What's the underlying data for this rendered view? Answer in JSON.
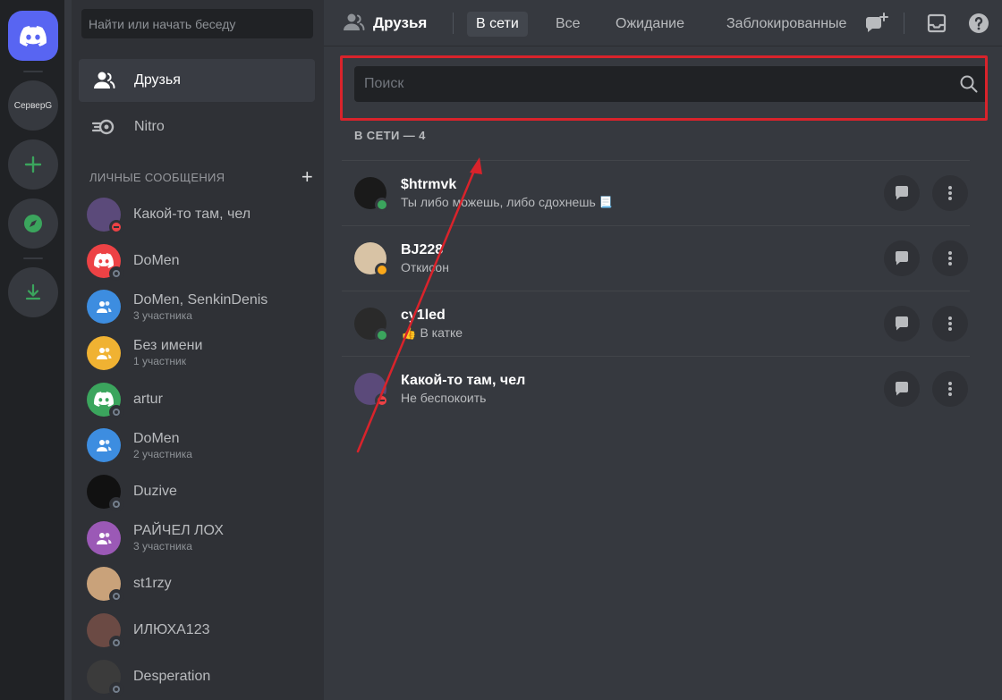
{
  "rail": {
    "server_label": "СерверG"
  },
  "sidebar": {
    "search_label": "Найти или начать беседу",
    "nav": [
      {
        "label": "Друзья"
      },
      {
        "label": "Nitro"
      }
    ],
    "dm_header": "ЛИЧНЫЕ СООБЩЕНИЯ",
    "dm_add": "+",
    "dms": [
      {
        "name": "Какой-то там, чел",
        "sub": "",
        "status": "dnd",
        "avatar": "#5b4a7a"
      },
      {
        "name": "DoMen",
        "sub": "",
        "status": "offline",
        "avatar": "#ed4245"
      },
      {
        "name": "DoMen, SenkinDenis",
        "sub": "3 участника",
        "status": "none",
        "avatar": "#3d8de0"
      },
      {
        "name": "Без имени",
        "sub": "1 участник",
        "status": "none",
        "avatar": "#f0b232"
      },
      {
        "name": "artur",
        "sub": "",
        "status": "offline",
        "avatar": "#3ba55d"
      },
      {
        "name": "DoMen",
        "sub": "2 участника",
        "status": "none",
        "avatar": "#3d8de0"
      },
      {
        "name": "Duzive",
        "sub": "",
        "status": "offline",
        "avatar": "#111111"
      },
      {
        "name": "РАЙЧЕЛ ЛОХ",
        "sub": "3 участника",
        "status": "none",
        "avatar": "#9b59b6"
      },
      {
        "name": "st1rzy",
        "sub": "",
        "status": "offline",
        "avatar": "#c9a27a"
      },
      {
        "name": "ИЛЮХА123",
        "sub": "",
        "status": "offline",
        "avatar": "#6b4a44"
      },
      {
        "name": "Desperation",
        "sub": "",
        "status": "offline",
        "avatar": "#3b3b3b"
      }
    ]
  },
  "topbar": {
    "title": "Друзья",
    "tabs": [
      {
        "label": "В сети"
      },
      {
        "label": "Все"
      },
      {
        "label": "Ожидание"
      },
      {
        "label": "Заблокированные"
      }
    ]
  },
  "search": {
    "placeholder": "Поиск",
    "value": ""
  },
  "section": {
    "title": "В СЕТИ — 4"
  },
  "friends": [
    {
      "name": "$htrmvk",
      "status_text": "Ты либо можешь, либо сдохнешь",
      "status": "online",
      "avatar": "#1a1a1a",
      "emoji": "📃"
    },
    {
      "name": "BJ228",
      "status_text": "Откисон",
      "status": "idle",
      "avatar": "#d8c3a5",
      "emoji": ""
    },
    {
      "name": "cy1led",
      "status_text": "В катке",
      "status": "online",
      "avatar": "#2a2a2a",
      "emoji": "👍"
    },
    {
      "name": "Какой-то там, чел",
      "status_text": "Не беспокоить",
      "status": "dnd",
      "avatar": "#5b4a7a",
      "emoji": ""
    }
  ],
  "colors": {
    "brand": "#5865f2",
    "green": "#3ba55d",
    "highlight": "#d9232b"
  }
}
